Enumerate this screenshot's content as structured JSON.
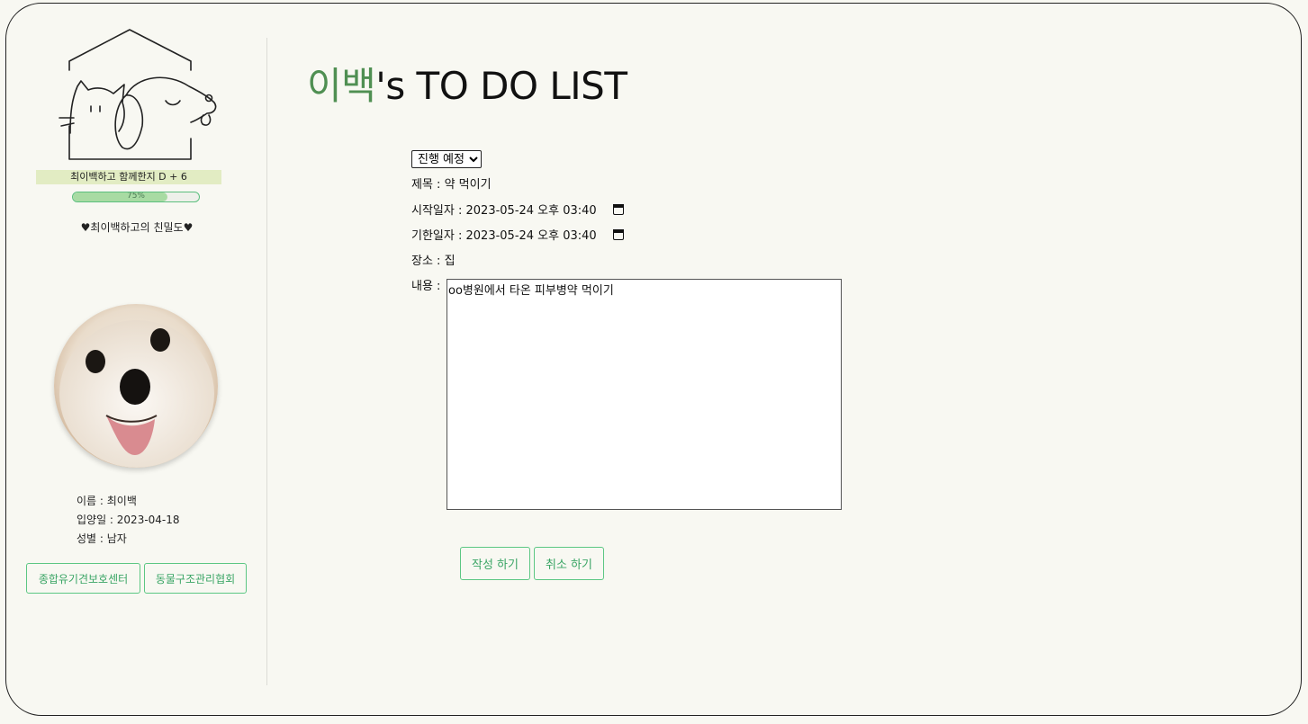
{
  "sidebar": {
    "dday": "최이백하고 함께한지 D + 6",
    "progress": {
      "label": "75%",
      "value": 0.75
    },
    "intimacy": "♥최이백하고의 친밀도♥",
    "info": {
      "name": "이름 : 최이백",
      "adopt_date": "입양일 : 2023-04-18",
      "gender": "성별 : 남자"
    },
    "links": [
      {
        "label": "종합유기견보호센터"
      },
      {
        "label": "동물구조관리협회"
      }
    ]
  },
  "main": {
    "title_name": "이백",
    "title_rest": "'s TO DO LIST",
    "status": {
      "selected": "진행 예정"
    },
    "subject": "제목 : 약 먹이기",
    "start": {
      "label": "시작일자 : ",
      "value": "2023-05-24 오후 03:40"
    },
    "end": {
      "label": "기한일자 : ",
      "value": "2023-05-24 오후 03:40"
    },
    "place": "장소 : 집",
    "content": {
      "label": "내용 : ",
      "value": "oo병원에서 타온 피부병약 먹이기"
    },
    "buttons": {
      "write": "작성 하기",
      "cancel": "취소 하기"
    }
  },
  "colors": {
    "accent_green": "#4f8f52",
    "button_green": "#3aa565",
    "background": "#f8f8f2",
    "dday_bg": "#e2ecc3"
  },
  "icons": [
    "house-cat-dog-logo-icon",
    "calendar-icon"
  ]
}
